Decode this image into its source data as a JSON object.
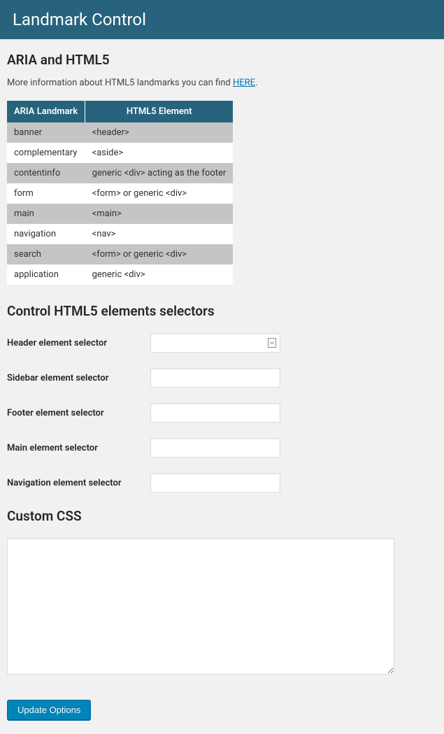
{
  "header": {
    "title": "Landmark Control"
  },
  "section_aria": {
    "title": "ARIA and HTML5",
    "info_prefix": "More information about HTML5 landmarks you can find ",
    "info_link": "HERE",
    "info_suffix": "."
  },
  "table": {
    "col1": "ARIA Landmark",
    "col2": "HTML5 Element",
    "rows": [
      {
        "aria": "banner",
        "html": "<header>"
      },
      {
        "aria": "complementary",
        "html": "<aside>"
      },
      {
        "aria": "contentinfo",
        "html": "generic <div> acting as the footer"
      },
      {
        "aria": "form",
        "html": "<form> or generic <div>"
      },
      {
        "aria": "main",
        "html": "<main>"
      },
      {
        "aria": "navigation",
        "html": "<nav>"
      },
      {
        "aria": "search",
        "html": "<form> or generic <div>"
      },
      {
        "aria": "application",
        "html": "generic <div>"
      }
    ]
  },
  "section_selectors": {
    "title": "Control HTML5 elements selectors",
    "fields": {
      "header": {
        "label": "Header element selector",
        "value": ""
      },
      "sidebar": {
        "label": "Sidebar element selector",
        "value": ""
      },
      "footer": {
        "label": "Footer element selector",
        "value": ""
      },
      "main": {
        "label": "Main element selector",
        "value": ""
      },
      "navigation": {
        "label": "Navigation element selector",
        "value": ""
      }
    }
  },
  "section_css": {
    "title": "Custom CSS",
    "value": ""
  },
  "actions": {
    "submit": "Update Options"
  }
}
